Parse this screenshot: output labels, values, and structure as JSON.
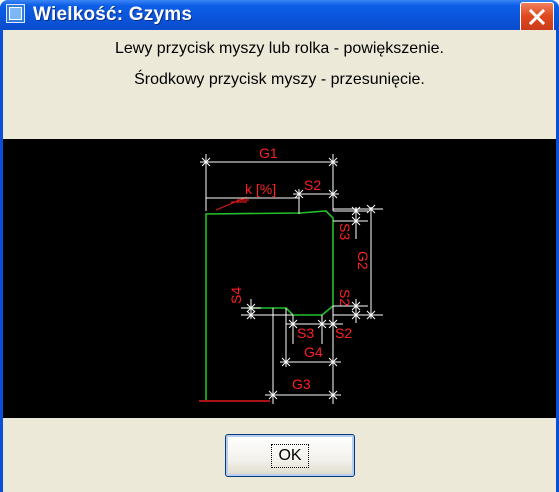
{
  "window": {
    "title": "Wielkość: Gzyms",
    "colors": {
      "titlebar": "#0a55dc",
      "close": "#e24a1e",
      "client": "#ece9d8",
      "canvas": "#000000",
      "dimension_lines": "#ffffff",
      "dimension_labels": "#ff2020",
      "profile": "#22c02a"
    }
  },
  "instructions": {
    "line1": "Lewy przycisk myszy lub rolka - powiększenie.",
    "line2": "Środkowy przycisk myszy - przesunięcie."
  },
  "drawing": {
    "labels": {
      "g1": "G1",
      "s2_top": "S2",
      "k_pct": "k [%]",
      "s3_right": "S3",
      "g2": "G2",
      "s2_right": "S2",
      "s4": "S4",
      "s3_bottom": "S3",
      "s2_bottom": "S2",
      "g4": "G4",
      "g3": "G3"
    }
  },
  "buttons": {
    "ok": "OK"
  },
  "icons": {
    "app": "app-icon",
    "close": "close-icon"
  }
}
